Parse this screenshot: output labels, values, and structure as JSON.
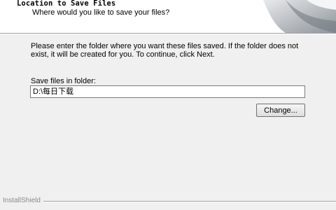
{
  "header": {
    "title": "Location to Save Files",
    "subtitle": "Where would you like to save your files?"
  },
  "body": {
    "instructions": "Please enter the folder where you want these files saved.  If the folder does not exist, it will be created for you.   To continue, click Next.",
    "folder_label": "Save files in folder:",
    "folder_value": "D:\\每日下载",
    "change_label": "Change..."
  },
  "footer": {
    "brand": "InstallShield"
  },
  "colors": {
    "header_bg": "#ffffff",
    "dialog_bg": "#f0f0f0"
  }
}
